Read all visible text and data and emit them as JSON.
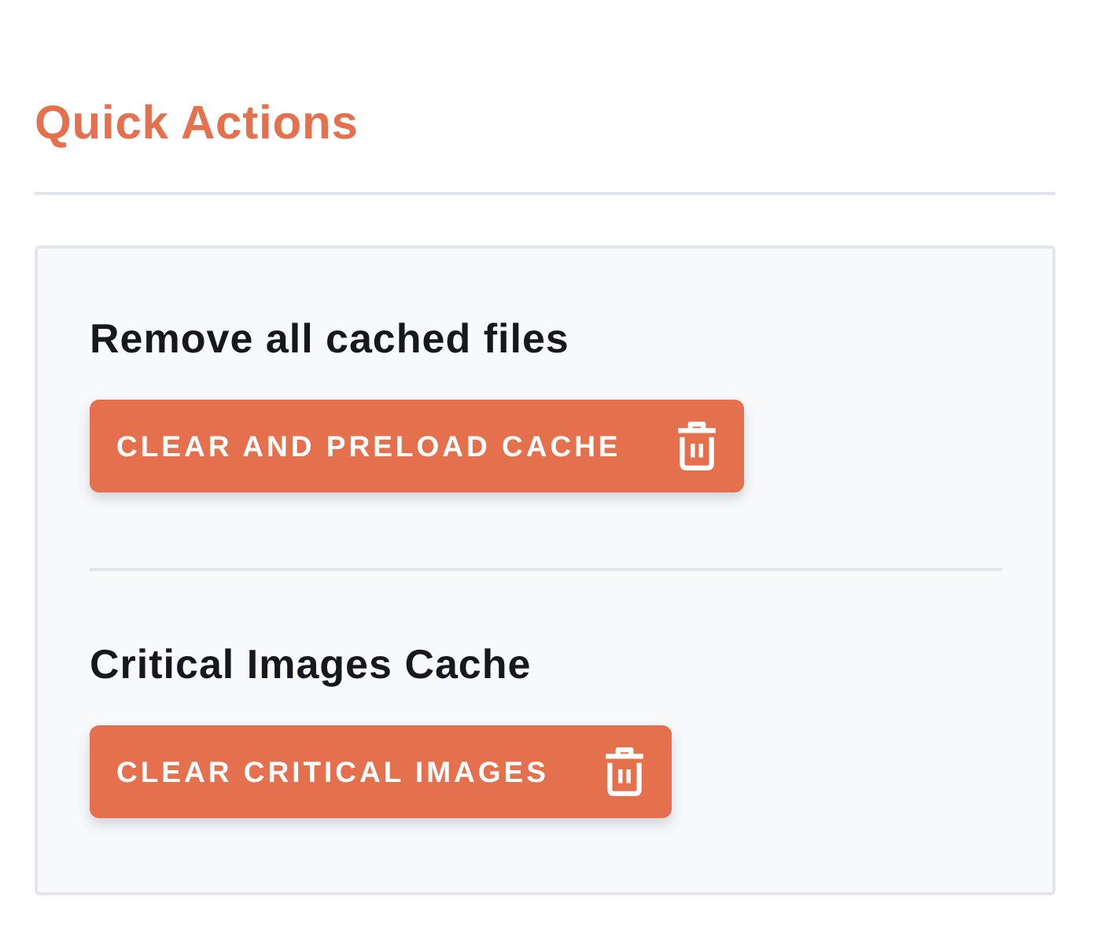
{
  "header": {
    "title": "Quick Actions"
  },
  "actions": [
    {
      "title": "Remove all cached files",
      "button": "CLEAR AND PRELOAD CACHE"
    },
    {
      "title": "Critical Images Cache",
      "button": "CLEAR CRITICAL IMAGES"
    }
  ]
}
